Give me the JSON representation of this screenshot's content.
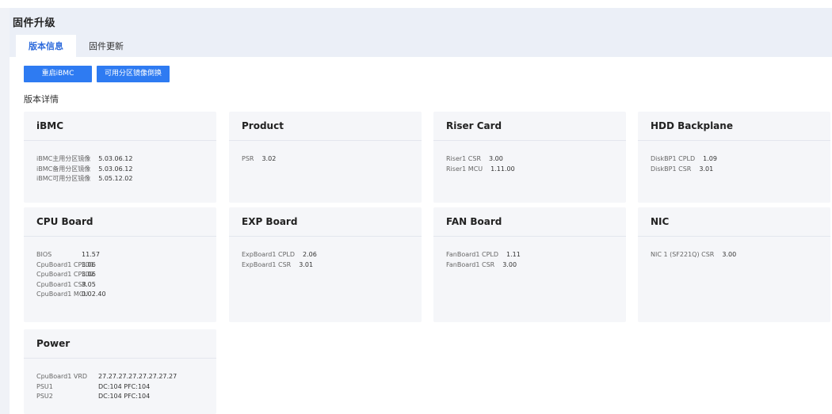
{
  "page": {
    "title": "固件升级",
    "tabs": [
      {
        "label": "版本信息",
        "active": true
      },
      {
        "label": "固件更新",
        "active": false
      }
    ],
    "buttons": {
      "restart": "重启iBMC",
      "switch": "可用分区镜像倒换"
    },
    "section_title": "版本详情"
  },
  "colors": {
    "accent": "#2e7bf2",
    "tab_active_text": "#2e6bdc",
    "header_bg": "#ebeff7",
    "card_bg": "#f5f6f9"
  },
  "cards": [
    {
      "title": "iBMC",
      "rows": [
        {
          "key": "iBMC主用分区镜像",
          "value": "5.03.06.12"
        },
        {
          "key": "iBMC备用分区镜像",
          "value": "5.03.06.12"
        },
        {
          "key": "iBMC可用分区镜像",
          "value": "5.05.12.02"
        }
      ]
    },
    {
      "title": "Product",
      "rows": [
        {
          "key": "PSR",
          "value": "3.02"
        }
      ]
    },
    {
      "title": "Riser Card",
      "rows": [
        {
          "key": "Riser1 CSR",
          "value": "3.00"
        },
        {
          "key": "Riser1 MCU",
          "value": "1.11.00"
        }
      ]
    },
    {
      "title": "HDD Backplane",
      "rows": [
        {
          "key": "DiskBP1 CPLD",
          "value": "1.09"
        },
        {
          "key": "DiskBP1 CSR",
          "value": "3.01"
        }
      ]
    },
    {
      "title": "CPU Board",
      "rows": [
        {
          "key": "BIOS",
          "value": "11.57"
        },
        {
          "key": "CpuBoard1 CPLD1",
          "value": "3.06"
        },
        {
          "key": "CpuBoard1 CPLD2",
          "value": "3.06"
        },
        {
          "key": "CpuBoard1 CSR",
          "value": "3.05"
        },
        {
          "key": "CpuBoard1 MCU",
          "value": "0.02.40"
        }
      ]
    },
    {
      "title": "EXP Board",
      "rows": [
        {
          "key": "ExpBoard1 CPLD",
          "value": "2.06"
        },
        {
          "key": "ExpBoard1 CSR",
          "value": "3.01"
        }
      ]
    },
    {
      "title": "FAN Board",
      "rows": [
        {
          "key": "FanBoard1 CPLD",
          "value": "1.11"
        },
        {
          "key": "FanBoard1 CSR",
          "value": "3.00"
        }
      ]
    },
    {
      "title": "NIC",
      "rows": [
        {
          "key": "NIC 1 (SF221Q) CSR",
          "value": "3.00"
        }
      ]
    },
    {
      "title": "Power",
      "rows": [
        {
          "key": "CpuBoard1 VRD",
          "value": "27.27.27.27.27.27.27.27"
        },
        {
          "key": "PSU1",
          "value": "DC:104 PFC:104"
        },
        {
          "key": "PSU2",
          "value": "DC:104 PFC:104"
        }
      ]
    }
  ]
}
